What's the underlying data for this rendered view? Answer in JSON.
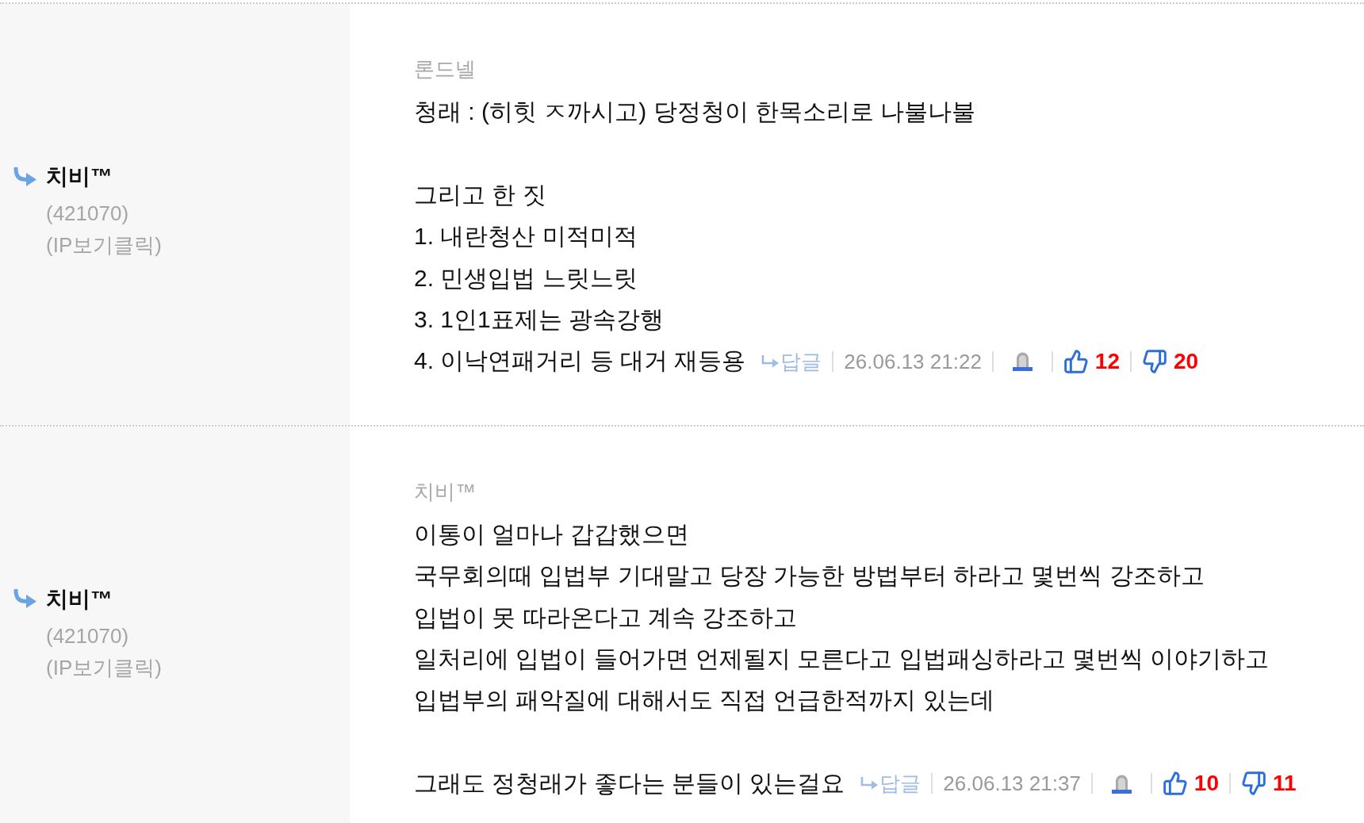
{
  "comments": [
    {
      "author": {
        "name": "치비™",
        "member_id": "(421070)",
        "ip_link": "(IP보기클릭)"
      },
      "reply_to": "론드넬",
      "paragraphs": [
        [
          "청래 : (히힛 ㅈ까시고) 당정청이 한목소리로 나불나불"
        ],
        [
          "그리고 한 짓",
          "1. 내란청산 미적미적",
          "2. 민생입법 느릿느릿",
          "3. 1인1표제는 광속강행",
          "4. 이낙연패거리 등 대거 재등용"
        ]
      ],
      "reply_label": "답글",
      "date": "26.06.13 21:22",
      "likes": "12",
      "dislikes": "20"
    },
    {
      "author": {
        "name": "치비™",
        "member_id": "(421070)",
        "ip_link": "(IP보기클릭)"
      },
      "reply_to": "치비™",
      "paragraphs": [
        [
          "이통이 얼마나 갑갑했으면",
          "국무회의때 입법부 기대말고 당장 가능한 방법부터 하라고 몇번씩 강조하고",
          "입법이 못 따라온다고 계속 강조하고",
          "일처리에 입법이 들어가면 언제될지 모른다고 입법패싱하라고 몇번씩 이야기하고",
          "입법부의 패악질에 대해서도 직접 언급한적까지 있는데"
        ],
        [
          "그래도 정청래가 좋다는 분들이 있는걸요"
        ]
      ],
      "reply_label": "답글",
      "date": "26.06.13 21:37",
      "likes": "10",
      "dislikes": "11"
    }
  ]
}
